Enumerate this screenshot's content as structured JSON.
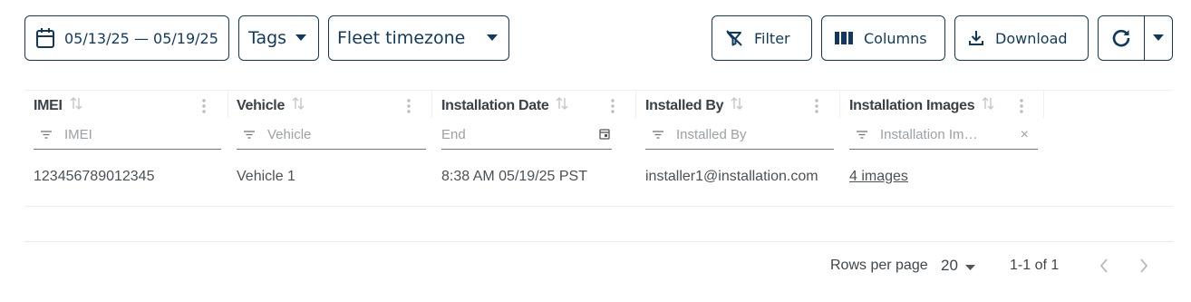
{
  "toolbar": {
    "date_range": "05/13/25 — 05/19/25",
    "tags_label": "Tags",
    "timezone_label": "Fleet timezone",
    "filter_label": "Filter",
    "columns_label": "Columns",
    "download_label": "Download"
  },
  "grid": {
    "columns": [
      {
        "title": "IMEI",
        "filter_placeholder": "IMEI"
      },
      {
        "title": "Vehicle",
        "filter_placeholder": "Vehicle"
      },
      {
        "title": "Installation Date",
        "filter_placeholder": "End"
      },
      {
        "title": "Installed By",
        "filter_placeholder": "Installed By"
      },
      {
        "title": "Installation Images",
        "filter_placeholder": "Installation Im…"
      }
    ],
    "rows": [
      {
        "imei": "123456789012345",
        "vehicle": "Vehicle 1",
        "installation_date": "8:38 AM 05/19/25 PST",
        "installed_by": "installer1@installation.com",
        "images": "4 images"
      }
    ]
  },
  "pagination": {
    "rows_per_page_label": "Rows per page",
    "rows_per_page_value": "20",
    "range": "1-1 of 1"
  },
  "colors": {
    "primary": "#0f3a5e",
    "text": "#444b52",
    "muted": "#9ba1a6"
  }
}
